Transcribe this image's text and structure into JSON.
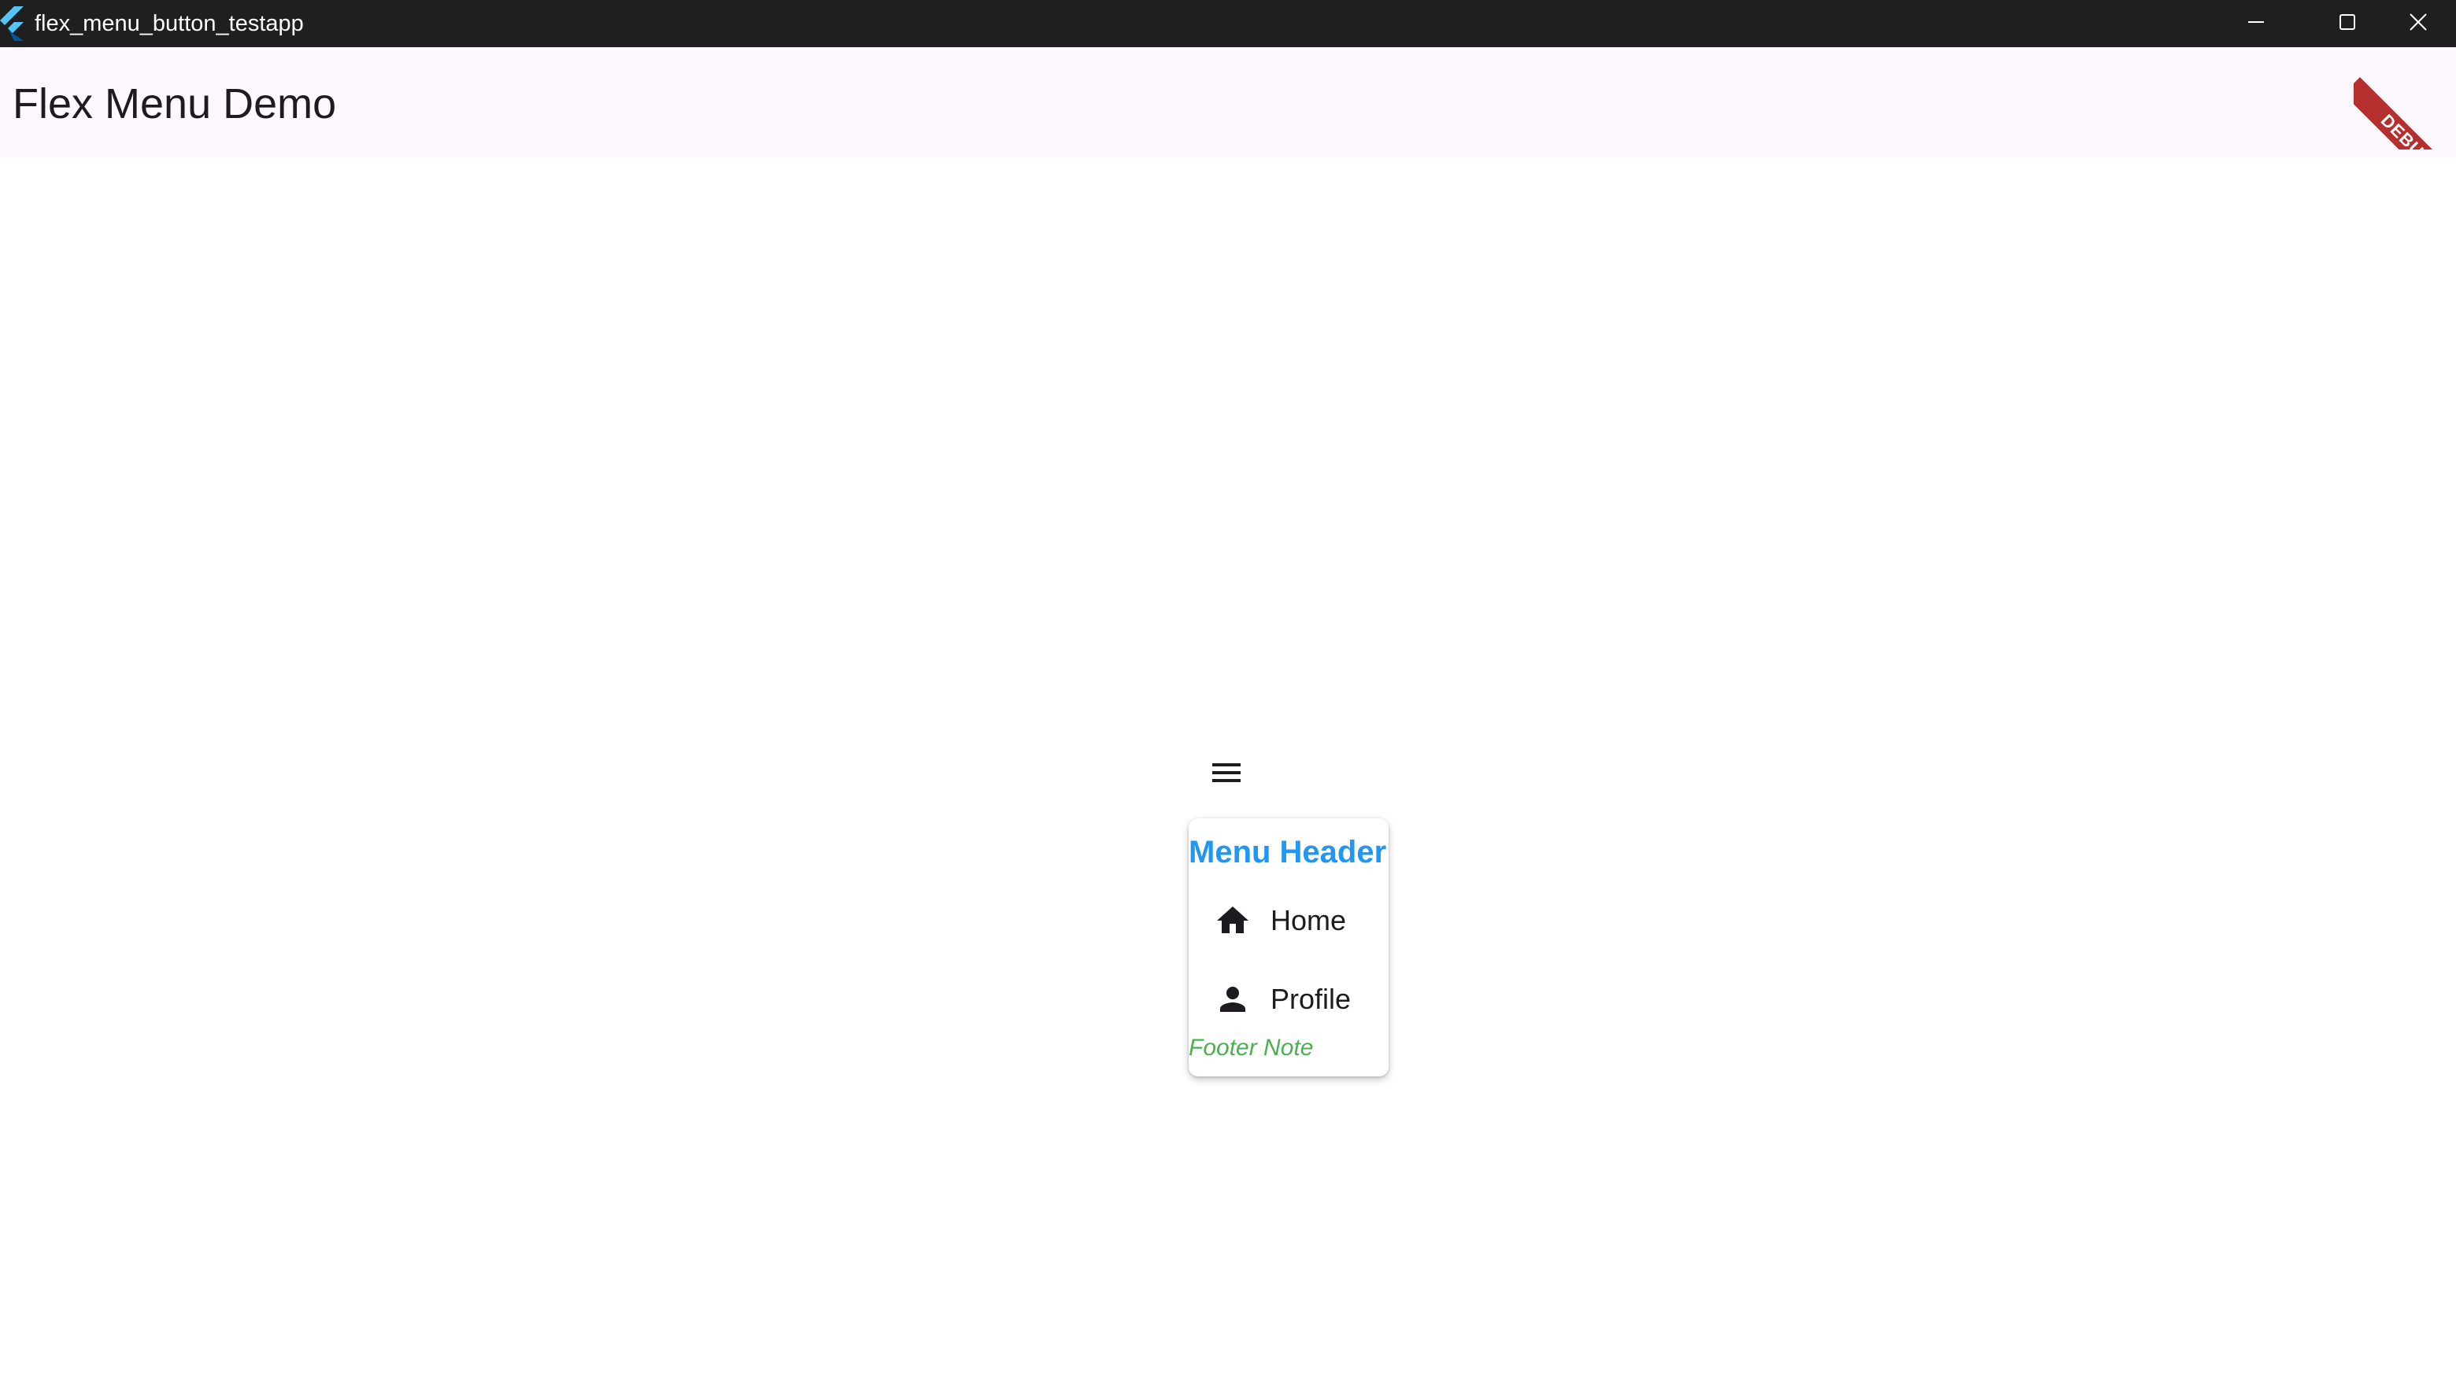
{
  "window": {
    "title": "flex_menu_button_testapp",
    "logo_icon": "flutter-logo-icon",
    "controls": [
      "minimize-icon",
      "maximize-icon",
      "close-icon"
    ]
  },
  "appbar": {
    "title": "Flex Menu Demo",
    "background": "#fdf7ff"
  },
  "debug_banner": {
    "label": "DEBUG",
    "color": "#b52f2f"
  },
  "menu_button": {
    "icon": "menu-icon"
  },
  "menu": {
    "header": "Menu Header",
    "header_color": "#2196f3",
    "items": [
      {
        "label": "Home",
        "icon": "home-icon"
      },
      {
        "label": "Profile",
        "icon": "person-icon"
      }
    ],
    "footer": "Footer Note",
    "footer_color": "#4caf50"
  }
}
